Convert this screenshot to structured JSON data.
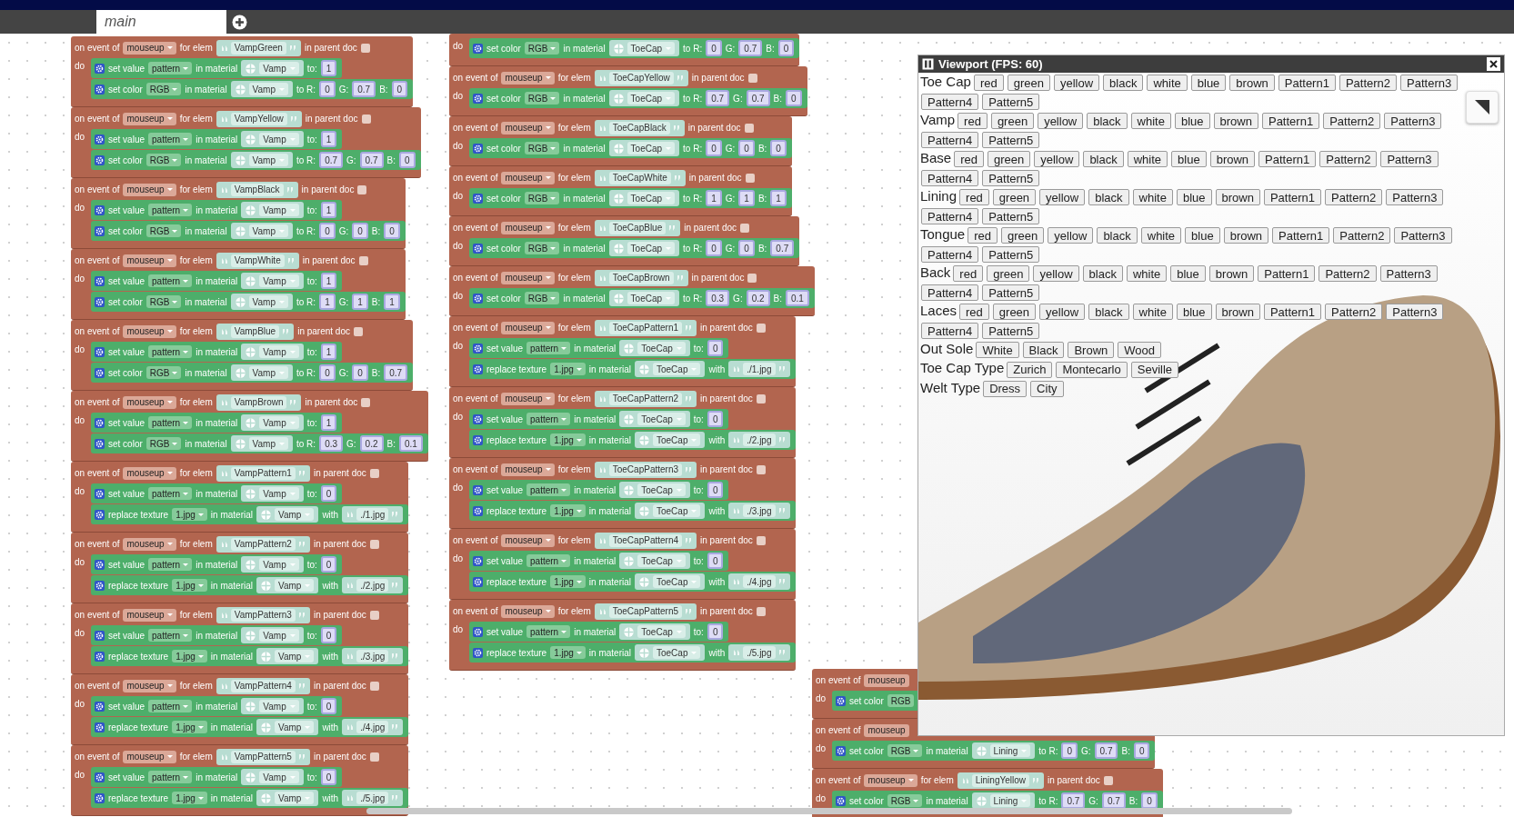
{
  "tabs": [
    {
      "label": "main",
      "selected": true
    }
  ],
  "stacks": [
    {
      "blocks": [
        {
          "head": [
            "on event of",
            "mouseup",
            "for elem",
            "VampGreen",
            "in parent doc"
          ],
          "checked": false,
          "do": "do",
          "actions": [
            {
              "kind": "value",
              "parts": [
                "set value",
                "pattern",
                "in material",
                "Vamp",
                "to:",
                "1"
              ]
            },
            {
              "kind": "color",
              "parts": [
                "set color",
                "RGB",
                "in material",
                "Vamp",
                "to R:",
                "0",
                "G:",
                "0.7",
                "B:",
                "0"
              ]
            }
          ]
        },
        {
          "head": [
            "on event of",
            "mouseup",
            "for elem",
            "VampYellow",
            "in parent doc"
          ],
          "checked": false,
          "do": "do",
          "actions": [
            {
              "kind": "value",
              "parts": [
                "set value",
                "pattern",
                "in material",
                "Vamp",
                "to:",
                "1"
              ]
            },
            {
              "kind": "color",
              "parts": [
                "set color",
                "RGB",
                "in material",
                "Vamp",
                "to R:",
                "0.7",
                "G:",
                "0.7",
                "B:",
                "0"
              ]
            }
          ]
        },
        {
          "head": [
            "on event of",
            "mouseup",
            "for elem",
            "VampBlack",
            "in parent doc"
          ],
          "checked": false,
          "do": "do",
          "actions": [
            {
              "kind": "value",
              "parts": [
                "set value",
                "pattern",
                "in material",
                "Vamp",
                "to:",
                "1"
              ]
            },
            {
              "kind": "color",
              "parts": [
                "set color",
                "RGB",
                "in material",
                "Vamp",
                "to R:",
                "0",
                "G:",
                "0",
                "B:",
                "0"
              ]
            }
          ]
        },
        {
          "head": [
            "on event of",
            "mouseup",
            "for elem",
            "VampWhite",
            "in parent doc"
          ],
          "checked": false,
          "do": "do",
          "actions": [
            {
              "kind": "value",
              "parts": [
                "set value",
                "pattern",
                "in material",
                "Vamp",
                "to:",
                "1"
              ]
            },
            {
              "kind": "color",
              "parts": [
                "set color",
                "RGB",
                "in material",
                "Vamp",
                "to R:",
                "1",
                "G:",
                "1",
                "B:",
                "1"
              ]
            }
          ]
        },
        {
          "head": [
            "on event of",
            "mouseup",
            "for elem",
            "VampBlue",
            "in parent doc"
          ],
          "checked": false,
          "do": "do",
          "actions": [
            {
              "kind": "value",
              "parts": [
                "set value",
                "pattern",
                "in material",
                "Vamp",
                "to:",
                "1"
              ]
            },
            {
              "kind": "color",
              "parts": [
                "set color",
                "RGB",
                "in material",
                "Vamp",
                "to R:",
                "0",
                "G:",
                "0",
                "B:",
                "0.7"
              ]
            }
          ]
        },
        {
          "head": [
            "on event of",
            "mouseup",
            "for elem",
            "VampBrown",
            "in parent doc"
          ],
          "checked": false,
          "do": "do",
          "actions": [
            {
              "kind": "value",
              "parts": [
                "set value",
                "pattern",
                "in material",
                "Vamp",
                "to:",
                "1"
              ]
            },
            {
              "kind": "color",
              "parts": [
                "set color",
                "RGB",
                "in material",
                "Vamp",
                "to R:",
                "0.3",
                "G:",
                "0.2",
                "B:",
                "0.1"
              ]
            }
          ]
        },
        {
          "head": [
            "on event of",
            "mouseup",
            "for elem",
            "VampPattern1",
            "in parent doc"
          ],
          "checked": false,
          "do": "do",
          "actions": [
            {
              "kind": "value",
              "parts": [
                "set value",
                "pattern",
                "in material",
                "Vamp",
                "to:",
                "0"
              ]
            },
            {
              "kind": "texture",
              "parts": [
                "replace texture",
                "1.jpg",
                "in material",
                "Vamp",
                "with",
                "./1.jpg"
              ]
            }
          ]
        },
        {
          "head": [
            "on event of",
            "mouseup",
            "for elem",
            "VampPattern2",
            "in parent doc"
          ],
          "checked": false,
          "do": "do",
          "actions": [
            {
              "kind": "value",
              "parts": [
                "set value",
                "pattern",
                "in material",
                "Vamp",
                "to:",
                "0"
              ]
            },
            {
              "kind": "texture",
              "parts": [
                "replace texture",
                "1.jpg",
                "in material",
                "Vamp",
                "with",
                "./2.jpg"
              ]
            }
          ]
        },
        {
          "head": [
            "on event of",
            "mouseup",
            "for elem",
            "VampPattern3",
            "in parent doc"
          ],
          "checked": false,
          "do": "do",
          "actions": [
            {
              "kind": "value",
              "parts": [
                "set value",
                "pattern",
                "in material",
                "Vamp",
                "to:",
                "0"
              ]
            },
            {
              "kind": "texture",
              "parts": [
                "replace texture",
                "1.jpg",
                "in material",
                "Vamp",
                "with",
                "./3.jpg"
              ]
            }
          ]
        },
        {
          "head": [
            "on event of",
            "mouseup",
            "for elem",
            "VampPattern4",
            "in parent doc"
          ],
          "checked": false,
          "do": "do",
          "actions": [
            {
              "kind": "value",
              "parts": [
                "set value",
                "pattern",
                "in material",
                "Vamp",
                "to:",
                "0"
              ]
            },
            {
              "kind": "texture",
              "parts": [
                "replace texture",
                "1.jpg",
                "in material",
                "Vamp",
                "with",
                "./4.jpg"
              ]
            }
          ]
        },
        {
          "head": [
            "on event of",
            "mouseup",
            "for elem",
            "VampPattern5",
            "in parent doc"
          ],
          "checked": false,
          "do": "do",
          "actions": [
            {
              "kind": "value",
              "parts": [
                "set value",
                "pattern",
                "in material",
                "Vamp",
                "to:",
                "0"
              ]
            },
            {
              "kind": "texture",
              "parts": [
                "replace texture",
                "1.jpg",
                "in material",
                "Vamp",
                "with",
                "./5.jpg"
              ]
            }
          ]
        }
      ]
    },
    {
      "blocks": [
        {
          "do": "do",
          "actions": [
            {
              "kind": "color",
              "parts": [
                "set color",
                "RGB",
                "in material",
                "ToeCap",
                "to R:",
                "0",
                "G:",
                "0.7",
                "B:",
                "0"
              ]
            }
          ]
        },
        {
          "head": [
            "on event of",
            "mouseup",
            "for elem",
            "ToeCapYellow",
            "in parent doc"
          ],
          "checked": false,
          "do": "do",
          "actions": [
            {
              "kind": "color",
              "parts": [
                "set color",
                "RGB",
                "in material",
                "ToeCap",
                "to R:",
                "0.7",
                "G:",
                "0.7",
                "B:",
                "0"
              ]
            }
          ]
        },
        {
          "head": [
            "on event of",
            "mouseup",
            "for elem",
            "ToeCapBlack",
            "in parent doc"
          ],
          "checked": false,
          "do": "do",
          "actions": [
            {
              "kind": "color",
              "parts": [
                "set color",
                "RGB",
                "in material",
                "ToeCap",
                "to R:",
                "0",
                "G:",
                "0",
                "B:",
                "0"
              ]
            }
          ]
        },
        {
          "head": [
            "on event of",
            "mouseup",
            "for elem",
            "ToeCapWhite",
            "in parent doc"
          ],
          "checked": false,
          "do": "do",
          "actions": [
            {
              "kind": "color",
              "parts": [
                "set color",
                "RGB",
                "in material",
                "ToeCap",
                "to R:",
                "1",
                "G:",
                "1",
                "B:",
                "1"
              ]
            }
          ]
        },
        {
          "head": [
            "on event of",
            "mouseup",
            "for elem",
            "ToeCapBlue",
            "in parent doc"
          ],
          "checked": false,
          "do": "do",
          "actions": [
            {
              "kind": "color",
              "parts": [
                "set color",
                "RGB",
                "in material",
                "ToeCap",
                "to R:",
                "0",
                "G:",
                "0",
                "B:",
                "0.7"
              ]
            }
          ]
        },
        {
          "head": [
            "on event of",
            "mouseup",
            "for elem",
            "ToeCapBrown",
            "in parent doc"
          ],
          "checked": false,
          "do": "do",
          "actions": [
            {
              "kind": "color",
              "parts": [
                "set color",
                "RGB",
                "in material",
                "ToeCap",
                "to R:",
                "0.3",
                "G:",
                "0.2",
                "B:",
                "0.1"
              ]
            }
          ]
        },
        {
          "head": [
            "on event of",
            "mouseup",
            "for elem",
            "ToeCapPattern1",
            "in parent doc"
          ],
          "checked": false,
          "do": "do",
          "actions": [
            {
              "kind": "value",
              "parts": [
                "set value",
                "pattern",
                "in material",
                "ToeCap",
                "to:",
                "0"
              ]
            },
            {
              "kind": "texture",
              "parts": [
                "replace texture",
                "1.jpg",
                "in material",
                "ToeCap",
                "with",
                "./1.jpg"
              ]
            }
          ]
        },
        {
          "head": [
            "on event of",
            "mouseup",
            "for elem",
            "ToeCapPattern2",
            "in parent doc"
          ],
          "checked": false,
          "do": "do",
          "actions": [
            {
              "kind": "value",
              "parts": [
                "set value",
                "pattern",
                "in material",
                "ToeCap",
                "to:",
                "0"
              ]
            },
            {
              "kind": "texture",
              "parts": [
                "replace texture",
                "1.jpg",
                "in material",
                "ToeCap",
                "with",
                "./2.jpg"
              ]
            }
          ]
        },
        {
          "head": [
            "on event of",
            "mouseup",
            "for elem",
            "ToeCapPattern3",
            "in parent doc"
          ],
          "checked": false,
          "do": "do",
          "actions": [
            {
              "kind": "value",
              "parts": [
                "set value",
                "pattern",
                "in material",
                "ToeCap",
                "to:",
                "0"
              ]
            },
            {
              "kind": "texture",
              "parts": [
                "replace texture",
                "1.jpg",
                "in material",
                "ToeCap",
                "with",
                "./3.jpg"
              ]
            }
          ]
        },
        {
          "head": [
            "on event of",
            "mouseup",
            "for elem",
            "ToeCapPattern4",
            "in parent doc"
          ],
          "checked": false,
          "do": "do",
          "actions": [
            {
              "kind": "value",
              "parts": [
                "set value",
                "pattern",
                "in material",
                "ToeCap",
                "to:",
                "0"
              ]
            },
            {
              "kind": "texture",
              "parts": [
                "replace texture",
                "1.jpg",
                "in material",
                "ToeCap",
                "with",
                "./4.jpg"
              ]
            }
          ]
        },
        {
          "head": [
            "on event of",
            "mouseup",
            "for elem",
            "ToeCapPattern5",
            "in parent doc"
          ],
          "checked": false,
          "do": "do",
          "actions": [
            {
              "kind": "value",
              "parts": [
                "set value",
                "pattern",
                "in material",
                "ToeCap",
                "to:",
                "0"
              ]
            },
            {
              "kind": "texture",
              "parts": [
                "replace texture",
                "1.jpg",
                "in material",
                "ToeCap",
                "with",
                "./5.jpg"
              ]
            }
          ]
        }
      ]
    },
    {
      "blocks": [
        {
          "head": [
            "on event of",
            "mouseup"
          ],
          "do": "do",
          "actions": [
            {
              "kind": "color",
              "parts": [
                "set color",
                "RGB"
              ]
            }
          ]
        },
        {
          "head": [
            "on event of",
            "mouseup"
          ],
          "do": "do",
          "actions": [
            {
              "kind": "color",
              "parts": [
                "set color",
                "RGB",
                "in material",
                "Lining",
                "to R:",
                "0",
                "G:",
                "0.7",
                "B:",
                "0"
              ]
            }
          ]
        },
        {
          "head": [
            "on event of",
            "mouseup",
            "for elem",
            "LiningYellow",
            "in parent doc"
          ],
          "checked": false,
          "do": "do",
          "actions": [
            {
              "kind": "color",
              "parts": [
                "set color",
                "RGB",
                "in material",
                "Lining",
                "to R:",
                "0.7",
                "G:",
                "0.7",
                "B:",
                "0"
              ]
            }
          ]
        }
      ]
    }
  ],
  "viewport": {
    "title": "Viewport (FPS: 60)",
    "groups": [
      {
        "label": "Toe Cap",
        "options": [
          "red",
          "green",
          "yellow",
          "black",
          "white",
          "blue",
          "brown",
          "Pattern1",
          "Pattern2",
          "Pattern3",
          "Pattern4",
          "Pattern5"
        ]
      },
      {
        "label": "Vamp",
        "options": [
          "red",
          "green",
          "yellow",
          "black",
          "white",
          "blue",
          "brown",
          "Pattern1",
          "Pattern2",
          "Pattern3",
          "Pattern4",
          "Pattern5"
        ]
      },
      {
        "label": "Base",
        "options": [
          "red",
          "green",
          "yellow",
          "black",
          "white",
          "blue",
          "brown",
          "Pattern1",
          "Pattern2",
          "Pattern3",
          "Pattern4",
          "Pattern5"
        ]
      },
      {
        "label": "Lining",
        "options": [
          "red",
          "green",
          "yellow",
          "black",
          "white",
          "blue",
          "brown",
          "Pattern1",
          "Pattern2",
          "Pattern3",
          "Pattern4",
          "Pattern5"
        ]
      },
      {
        "label": "Tongue",
        "options": [
          "red",
          "green",
          "yellow",
          "black",
          "white",
          "blue",
          "brown",
          "Pattern1",
          "Pattern2",
          "Pattern3",
          "Pattern4",
          "Pattern5"
        ]
      },
      {
        "label": "Back",
        "options": [
          "red",
          "green",
          "yellow",
          "black",
          "white",
          "blue",
          "brown",
          "Pattern1",
          "Pattern2",
          "Pattern3",
          "Pattern4",
          "Pattern5"
        ]
      },
      {
        "label": "Laces",
        "options": [
          "red",
          "green",
          "yellow",
          "black",
          "white",
          "blue",
          "brown",
          "Pattern1",
          "Pattern2",
          "Pattern3",
          "Pattern4",
          "Pattern5"
        ]
      },
      {
        "label": "Out Sole",
        "options": [
          "White",
          "Black",
          "Brown",
          "Wood"
        ]
      },
      {
        "label": "Toe Cap Type",
        "options": [
          "Zurich",
          "Montecarlo",
          "Seville"
        ]
      },
      {
        "label": "Welt Type",
        "options": [
          "Dress",
          "City"
        ]
      }
    ]
  }
}
